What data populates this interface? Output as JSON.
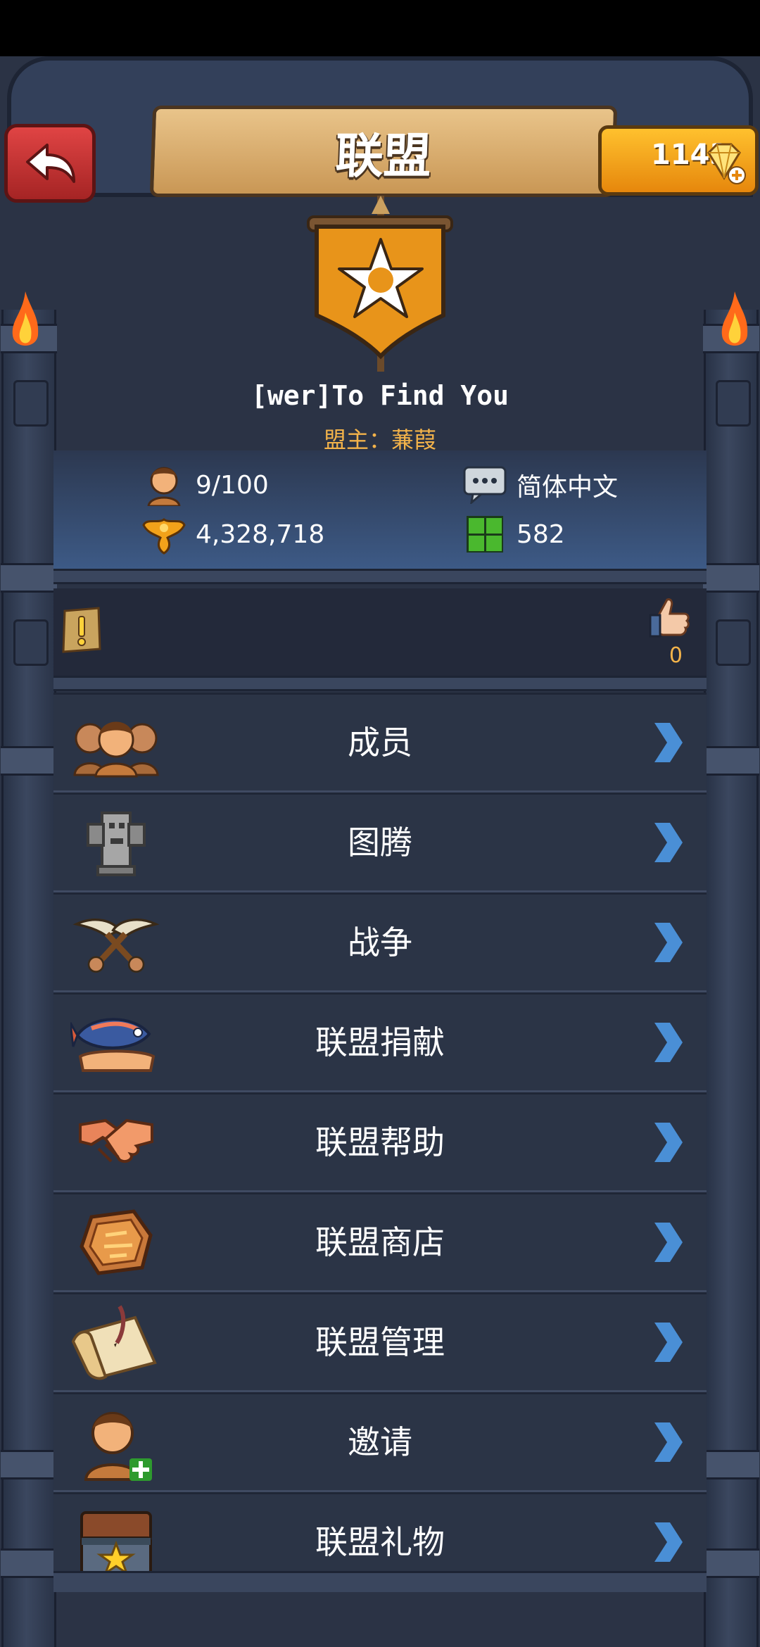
{
  "header": {
    "title": "联盟",
    "gems": "1143"
  },
  "alliance": {
    "name": "[wer]To Find You",
    "leader_label": "盟主：",
    "leader_name": "蒹葭",
    "members": "9/100",
    "language": "简体中文",
    "power": "4,328,718",
    "territory": "582"
  },
  "notice": {
    "likes": "0"
  },
  "menu": [
    {
      "label": "成员",
      "icon": "members-icon"
    },
    {
      "label": "图腾",
      "icon": "totem-icon"
    },
    {
      "label": "战争",
      "icon": "war-axes-icon"
    },
    {
      "label": "联盟捐献",
      "icon": "fish-donation-icon"
    },
    {
      "label": "联盟帮助",
      "icon": "handshake-icon"
    },
    {
      "label": "联盟商店",
      "icon": "shop-rock-icon"
    },
    {
      "label": "联盟管理",
      "icon": "scroll-quill-icon"
    },
    {
      "label": "邀请",
      "icon": "invite-person-icon"
    },
    {
      "label": "联盟礼物",
      "icon": "gift-chest-icon"
    }
  ],
  "colors": {
    "background": "#2b3345",
    "gold": "#f3b34a",
    "arrow": "#4a8fd6",
    "back_button": "#c83030"
  }
}
